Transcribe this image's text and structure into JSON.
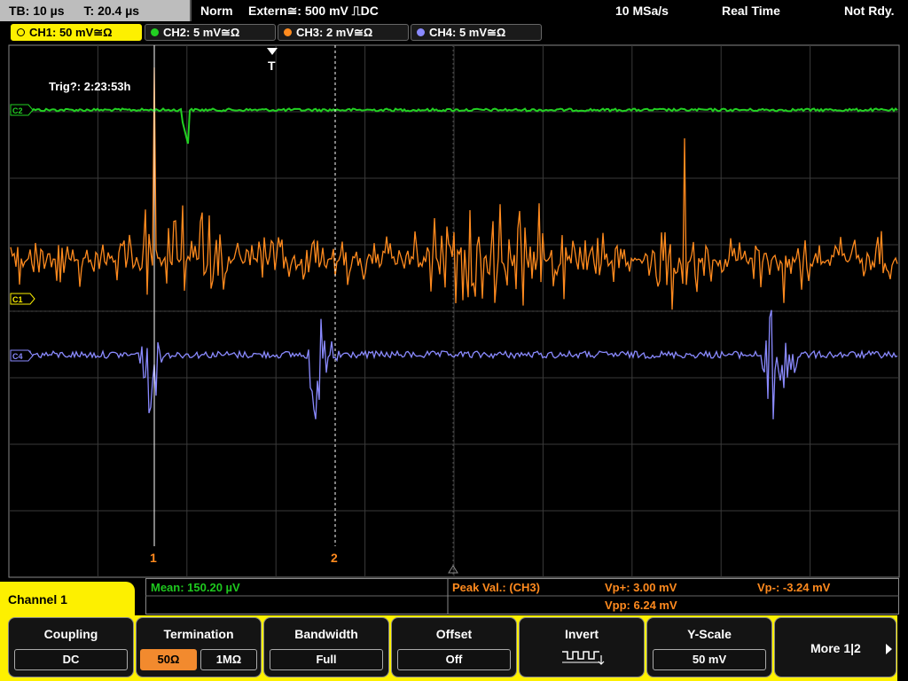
{
  "status": {
    "timebase": "TB: 10 µs",
    "trigger_time": "T: 20.4 µs",
    "mode": "Norm",
    "trigger": "Extern≅: 500 mV ⎍DC",
    "sample_rate": "10 MSa/s",
    "acquisition": "Real Time",
    "state": "Not Rdy."
  },
  "channels": [
    {
      "label": "CH1: 50 mV≅Ω",
      "color": "#fdf000",
      "active": true
    },
    {
      "label": "CH2: 5 mV≅Ω",
      "color": "#22d022"
    },
    {
      "label": "CH3: 2 mV≅Ω",
      "color": "#ff8a1e"
    },
    {
      "label": "CH4: 5 mV≅Ω",
      "color": "#8a8aff"
    }
  ],
  "waveform": {
    "trigger_readout": "Trig?: 2:23:53h",
    "trigger_marker": "T",
    "cursor_1": "1",
    "cursor_2": "2",
    "ch2_marker": "C2",
    "ch3_marker": "C1",
    "ch4_marker": "C4",
    "colors": {
      "ch2": "#22d022",
      "ch3": "#ff8a1e",
      "ch4": "#8a8aff",
      "grid": "#3a3a3a"
    }
  },
  "measurements": {
    "mean": "Mean: 150.20 µV",
    "peak": "Peak Val.:  (CH3)",
    "vp_plus": "Vp+: 3.00 mV",
    "vpp": "Vpp: 6.24 mV",
    "vp_minus": "Vp-: -3.24 mV"
  },
  "panel": {
    "channel_title": "Channel 1",
    "softkeys": {
      "coupling": {
        "title": "Coupling",
        "value": "DC"
      },
      "termination": {
        "title": "Termination",
        "options": [
          "50Ω",
          "1MΩ"
        ],
        "selected": "50Ω"
      },
      "bandwidth": {
        "title": "Bandwidth",
        "value": "Full"
      },
      "offset": {
        "title": "Offset",
        "value": "Off"
      },
      "invert": {
        "title": "Invert"
      },
      "yscale": {
        "title": "Y-Scale",
        "value": "50 mV"
      },
      "more": {
        "label": "More 1|2"
      }
    }
  }
}
